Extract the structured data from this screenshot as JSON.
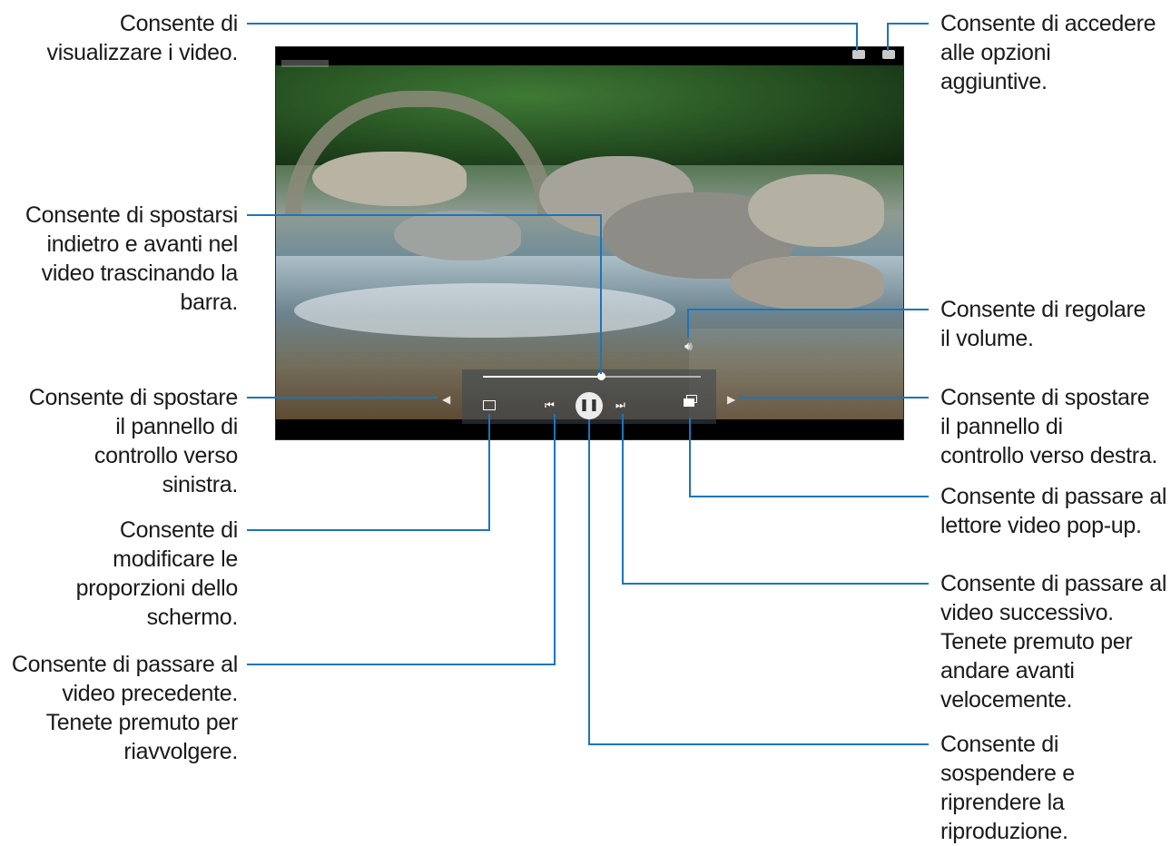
{
  "annotations": {
    "view_video": "Consente di\nvisualizzare i video.",
    "more_options": "Consente di accedere\nalle opzioni\naggiuntive.",
    "seek_bar": "Consente di spostarsi\nindietro e avanti nel\nvideo trascinando la\nbarra.",
    "volume": "Consente di regolare\nil volume.",
    "move_left": "Consente di spostare\nil pannello di\ncontrollo verso\nsinistra.",
    "move_right": "Consente di spostare\nil pannello di\ncontrollo verso destra.",
    "aspect_ratio": "Consente di\nmodificare le\nproporzioni dello\nschermo.",
    "popup_player": "Consente di passare al\nlettore video pop-up.",
    "previous": "Consente di passare al\nvideo precedente.\nTenete premuto per\nriavvolgere.",
    "next": "Consente di passare al\nvideo successivo.\nTenete premuto per\nandare avanti\nvelocemente.",
    "pause": "Consente di\nsospendere e\nriprendere la\nriproduzione."
  },
  "player": {
    "progress": 0.54,
    "icons": {
      "view": "view-video-icon",
      "more": "more-options-icon",
      "volume": "volume-icon",
      "aspect": "aspect-ratio-icon",
      "prev": "previous-icon",
      "pause": "pause-icon",
      "next": "next-icon",
      "popup": "popup-player-icon",
      "left": "move-left-arrow-icon",
      "right": "move-right-arrow-icon"
    },
    "line_color": "#1b75bc"
  }
}
